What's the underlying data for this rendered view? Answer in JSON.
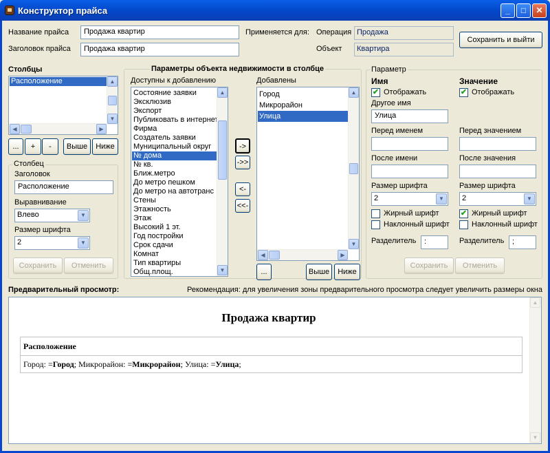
{
  "window": {
    "title": "Конструктор прайса"
  },
  "header": {
    "name_label": "Название прайса",
    "name_value": "Продажа квартир",
    "heading_label": "Заголовок прайса",
    "heading_value": "Продажа квартир",
    "applies_label": "Применяется для:",
    "operation_label": "Операция",
    "operation_value": "Продажа",
    "object_label": "Объект",
    "object_value": "Квартира",
    "save_exit": "Сохранить и выйти"
  },
  "columns": {
    "title": "Столбцы",
    "items": [
      "Расположение"
    ],
    "btn_more": "...",
    "btn_add": "+",
    "btn_remove": "-",
    "btn_up": "Выше",
    "btn_down": "Ниже"
  },
  "column_group": {
    "title": "Столбец",
    "heading_label": "Заголовок",
    "heading_value": "Расположение",
    "align_label": "Выравнивание",
    "align_value": "Влево",
    "font_label": "Размер шрифта",
    "font_value": "2",
    "save": "Сохранить",
    "cancel": "Отменить"
  },
  "params": {
    "title": "Параметры объекта недвижимости в столбце",
    "available_label": "Доступны к добавлению",
    "available": [
      "Состояние заявки",
      "Эксклюзив",
      "Экспорт",
      "Публиковать в интернет",
      "Фирма",
      "Создатель заявки",
      "Муниципальный округ",
      "№ дома",
      "№ кв.",
      "Ближ.метро",
      "До метро пешком",
      "До метро на автотранс",
      "Стены",
      "Этажность",
      "Этаж",
      "Высокий 1 эт.",
      "Год постройки",
      "Срок сдачи",
      "Комнат",
      "Тип квартиры",
      "Общ.площ."
    ],
    "available_selected": 7,
    "added_label": "Добавлены",
    "added": [
      "Город",
      "Микрорайон",
      "Улица"
    ],
    "added_selected": 2,
    "move_one_right": "->",
    "move_all_right": "->>",
    "move_one_left": "<-",
    "move_all_left": "<<-",
    "btn_more": "...",
    "btn_up": "Выше",
    "btn_down": "Ниже"
  },
  "parameter": {
    "title": "Параметр",
    "name_header": "Имя",
    "value_header": "Значение",
    "show_label": "Отображать",
    "show_name_checked": true,
    "show_value_checked": true,
    "other_name_label": "Другое имя",
    "other_name_value": "Улица",
    "before_name_label": "Перед именем",
    "before_value_label": "Перед значением",
    "after_name_label": "После имени",
    "after_value_label": "После значения",
    "font_size_label": "Размер шрифта",
    "name_font_value": "2",
    "value_font_value": "2",
    "bold_label": "Жирный шрифт",
    "italic_label": "Наклонный шрифт",
    "name_bold": false,
    "name_italic": false,
    "value_bold": true,
    "value_italic": false,
    "separator_label": "Разделитель",
    "name_separator": ":",
    "value_separator": ";",
    "save": "Сохранить",
    "cancel": "Отменить"
  },
  "preview": {
    "label": "Предварительный просмотр:",
    "hint": "Рекомендация: для увеличения зоны предварительного просмотра следует увеличить размеры окна",
    "doc_title": "Продажа квартир",
    "column_header": "Расположение",
    "row": {
      "city_prefix": "Город: =",
      "city_value": "Город",
      "district_prefix": "; Микрорайон: =",
      "district_value": "Микрорайон",
      "street_prefix": "; Улица: =",
      "street_value": "Улица",
      "suffix": ";"
    }
  }
}
